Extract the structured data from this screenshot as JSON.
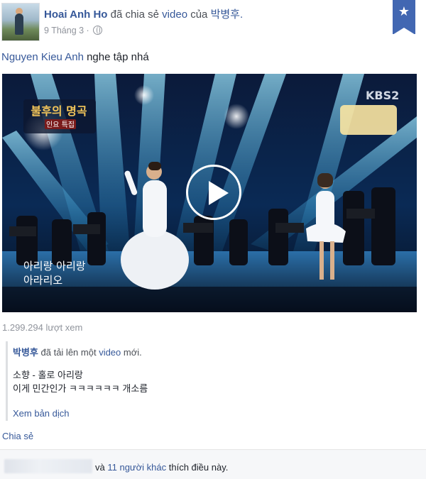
{
  "post": {
    "author": "Hoai Anh Ho",
    "action_text": "đã chia sẻ",
    "video_link": "video",
    "of_text": "của",
    "original_author": "박병후.",
    "date": "9 Tháng 3 ·",
    "privacy_icon": "globe-icon",
    "bookmark_icon": "star-icon",
    "tagged_name": "Nguyen Kieu Anh",
    "message": "nghe tập nhá"
  },
  "video": {
    "channel_logo": "KBS2",
    "overlay_title": "불후의 명곡",
    "overlay_sub": "인요 특집",
    "caption_line1": "아리랑 아리랑",
    "caption_line2": "아라리오",
    "play_icon": "play-icon"
  },
  "stats": {
    "views": "1.299.294 lượt xem"
  },
  "attachment": {
    "uploader": "박병후",
    "upload_text": "đã tải lên một",
    "video_word": "video",
    "new_text": "mới.",
    "desc_line1": "소향 - 홀로 아리랑",
    "desc_line2": "이게 민간인가 ㅋㅋㅋㅋㅋㅋ 개소름",
    "translate": "Xem bản dịch"
  },
  "actions": {
    "share": "Chia sẻ"
  },
  "likes": {
    "prefix": "và",
    "others": "11 người khác",
    "suffix": "thích điều này."
  },
  "colors": {
    "link": "#365899",
    "bookmark": "#4267b2",
    "meta": "#90949c"
  }
}
